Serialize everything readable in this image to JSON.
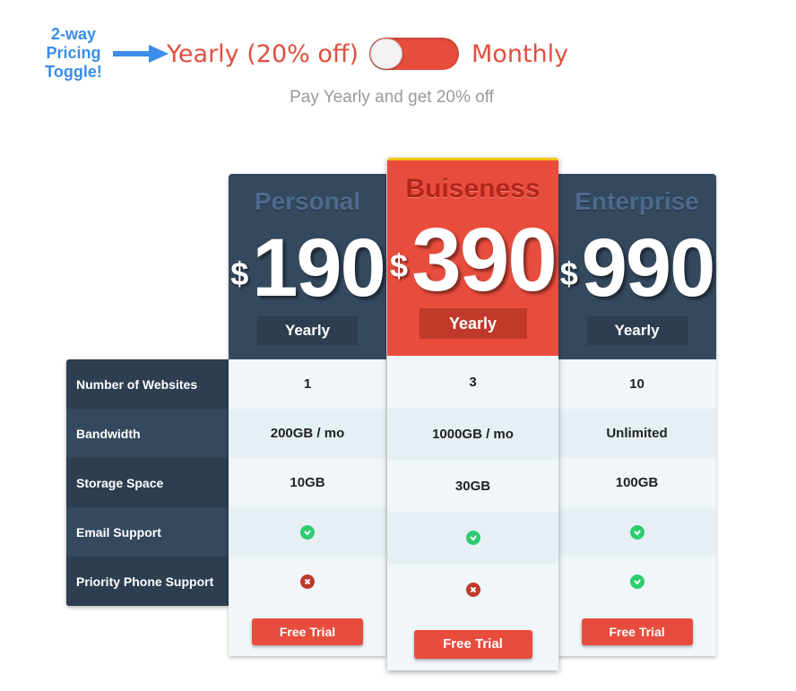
{
  "annotation": {
    "line1": "2-way",
    "line2": "Pricing",
    "line3": "Toggle!"
  },
  "toggle": {
    "yearly_label": "Yearly (20% off)",
    "monthly_label": "Monthly",
    "subtitle": "Pay Yearly and get 20% off"
  },
  "features": [
    "Number of Websites",
    "Bandwidth",
    "Storage Space",
    "Email Support",
    "Priority Phone Support"
  ],
  "plans": [
    {
      "name": "Personal",
      "currency": "$",
      "price": "190",
      "period": "Yearly",
      "websites": "1",
      "bandwidth": "200GB / mo",
      "storage": "10GB",
      "email": "check",
      "phone": "cross",
      "cta": "Free Trial"
    },
    {
      "name": "Buiseness",
      "currency": "$",
      "price": "390",
      "period": "Yearly",
      "websites": "3",
      "bandwidth": "1000GB / mo",
      "storage": "30GB",
      "email": "check",
      "phone": "cross",
      "cta": "Free Trial"
    },
    {
      "name": "Enterprise",
      "currency": "$",
      "price": "990",
      "period": "Yearly",
      "websites": "10",
      "bandwidth": "Unlimited",
      "storage": "100GB",
      "email": "check",
      "phone": "check",
      "cta": "Free Trial"
    }
  ],
  "colors": {
    "accent": "#e84c3d",
    "dark": "#34495e",
    "check": "#2ecc71",
    "cross": "#c0392b",
    "featured_top": "#f1c40f"
  }
}
